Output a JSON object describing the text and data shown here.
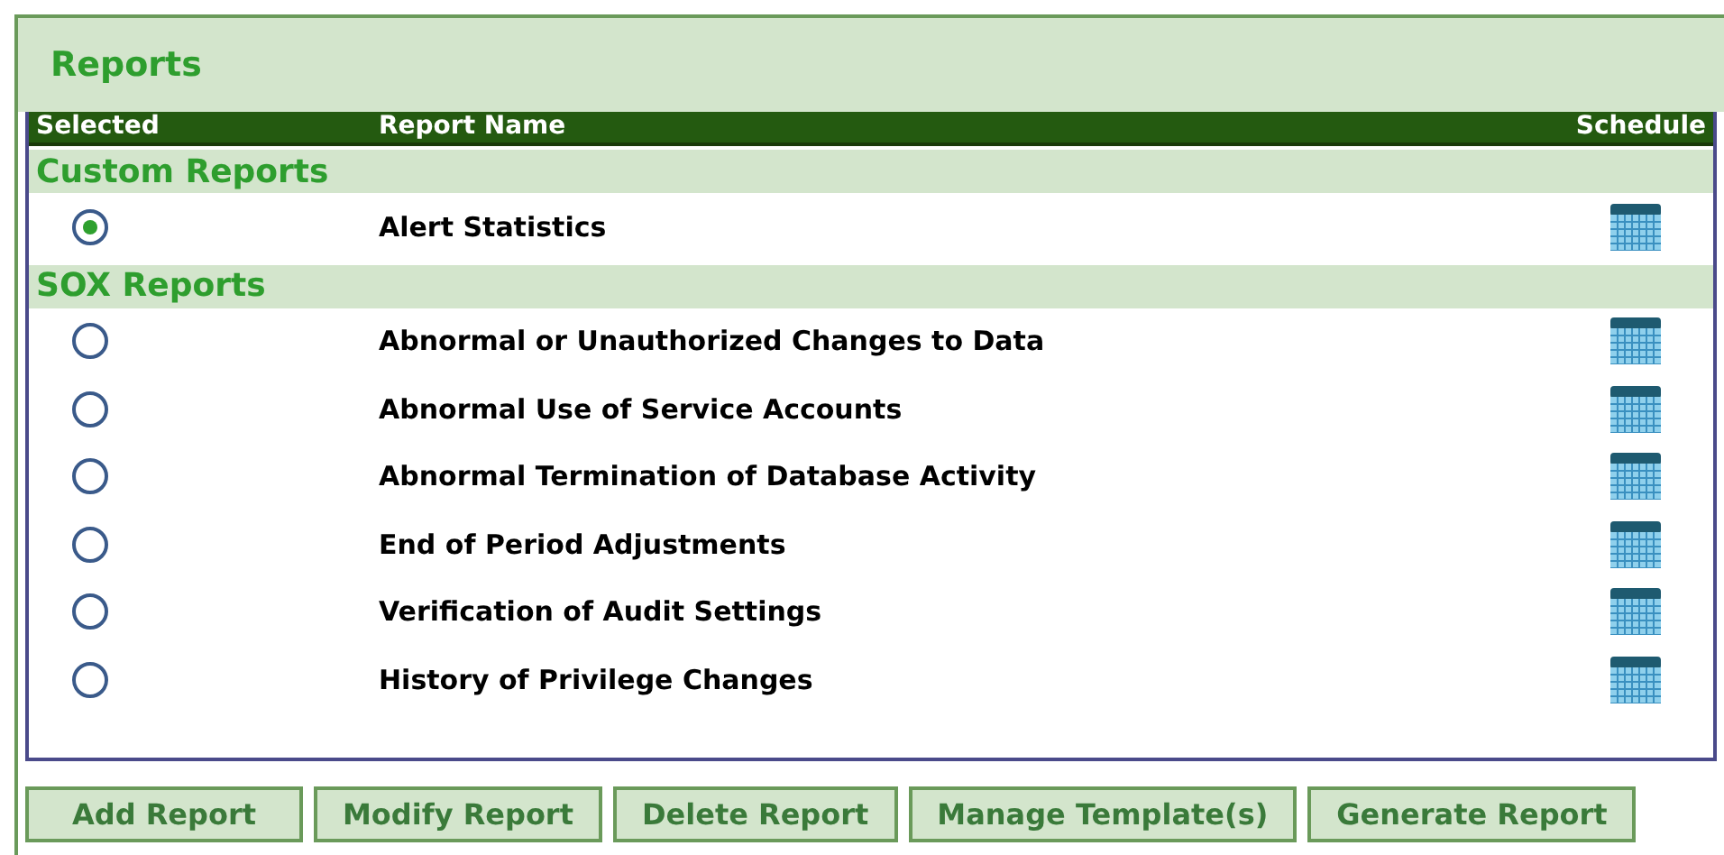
{
  "panel": {
    "title": "Reports"
  },
  "table": {
    "columns": [
      "Selected",
      "Report Name",
      "Schedule"
    ],
    "groups": [
      {
        "title": "Custom Reports",
        "reports": [
          {
            "name": "Alert Statistics",
            "selected": true
          }
        ]
      },
      {
        "title": "SOX Reports",
        "reports": [
          {
            "name": "Abnormal or Unauthorized Changes to Data",
            "selected": false
          },
          {
            "name": "Abnormal Use of Service Accounts",
            "selected": false
          },
          {
            "name": "Abnormal Termination of Database Activity",
            "selected": false
          },
          {
            "name": "End of Period Adjustments",
            "selected": false
          },
          {
            "name": "Verification of Audit Settings",
            "selected": false
          },
          {
            "name": "History of Privilege Changes",
            "selected": false
          }
        ]
      }
    ]
  },
  "buttons": [
    "Add Report",
    "Modify Report",
    "Delete Report",
    "Manage Template(s)",
    "Generate Report"
  ]
}
